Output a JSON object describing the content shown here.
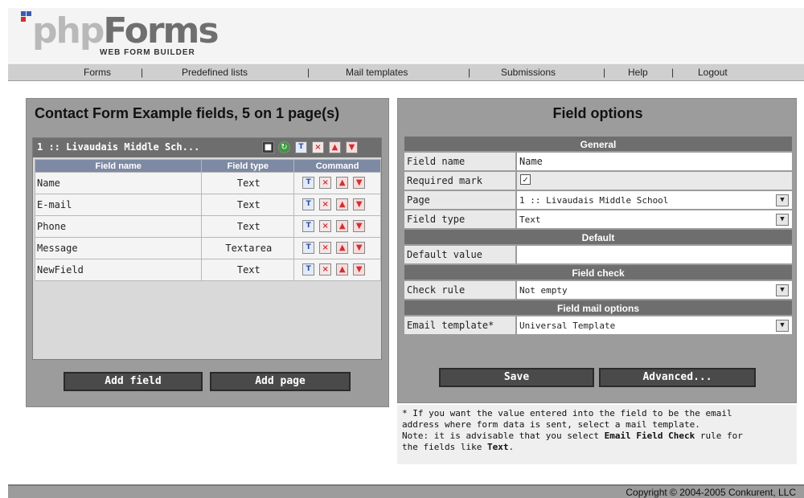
{
  "brand": {
    "logo_text_1": "php",
    "logo_text_2": "Forms",
    "tagline": "WEB FORM BUILDER"
  },
  "nav": {
    "items": [
      "Forms",
      "Predefined lists",
      "Mail templates",
      "Submissions",
      "Help",
      "Logout"
    ],
    "separator": "|"
  },
  "left": {
    "title": "Contact Form Example fields, 5 on 1 page(s)",
    "page_header": "1 :: Livaudais Middle Sch...",
    "columns": [
      "Field name",
      "Field type",
      "Command"
    ],
    "rows": [
      {
        "name": "Name",
        "type": "Text"
      },
      {
        "name": "E-mail",
        "type": "Text"
      },
      {
        "name": "Phone",
        "type": "Text"
      },
      {
        "name": "Message",
        "type": "Textarea"
      },
      {
        "name": "NewField",
        "type": "Text"
      }
    ],
    "add_field": "Add field",
    "add_page": "Add page"
  },
  "right": {
    "title": "Field options",
    "section_general": "General",
    "field_name_label": "Field name",
    "field_name_value": "Name",
    "required_label": "Required mark",
    "required_checked": true,
    "page_label": "Page",
    "page_value": "1 :: Livaudais Middle School",
    "field_type_label": "Field type",
    "field_type_value": "Text",
    "section_default": "Default",
    "default_label": "Default value",
    "default_value": "",
    "section_check": "Field check",
    "check_label": "Check rule",
    "check_value": "Not empty",
    "section_mail": "Field mail options",
    "email_label": "Email template*",
    "email_value": "Universal Template",
    "save": "Save",
    "advanced": "Advanced..."
  },
  "note": {
    "line1": "* If you want the value entered into the field to be the email",
    "line2": "address where form data is sent, select a mail template.",
    "line3_pre": "Note: it is advisable that you select ",
    "line3_bold": "Email Field Check",
    "line3_post": " rule for",
    "line4_pre": "the fields like ",
    "line4_bold": "Text",
    "line4_post": "."
  },
  "footer": {
    "copyright": "Copyright © 2004-2005 Conkurent, LLC"
  },
  "colors": {
    "panel": "#9c9c9c",
    "header_bar": "#6e6e6e",
    "table_head": "#7e8aa3"
  }
}
